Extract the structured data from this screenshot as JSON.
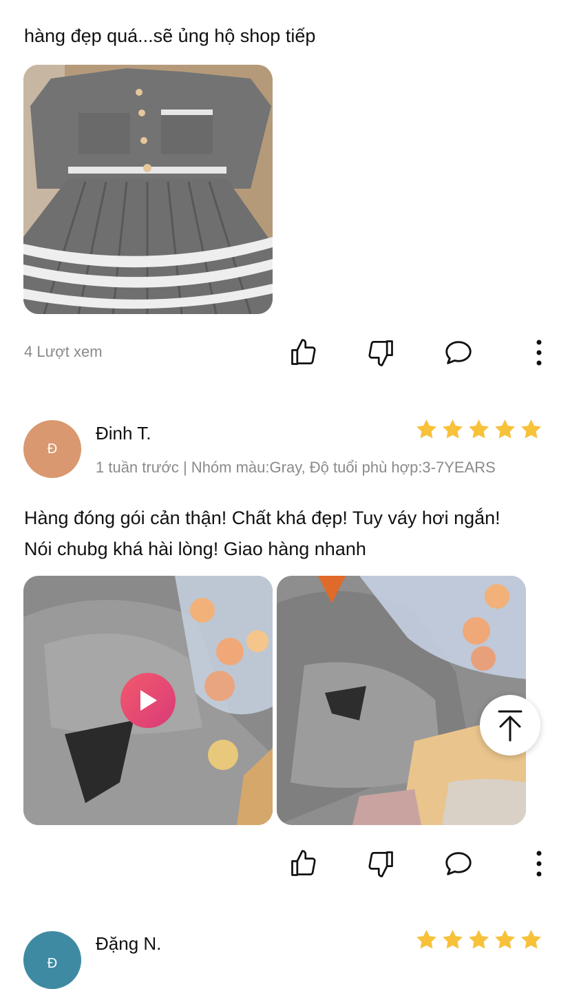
{
  "review1": {
    "text": "hàng đẹp quá...sẽ ủng hộ shop tiếp",
    "photo": "gray knit cardigan and pleated skirt photo",
    "views": "4 Lượt xem"
  },
  "review2": {
    "avatar_letter": "Đ",
    "avatar_color": "#d9986f",
    "name": "Đinh T.",
    "rating": 5,
    "meta": "1 tuần trước | Nhóm màu:Gray, Độ tuổi phù hợp:3-7YEARS",
    "text_line1": "Hàng đóng gói cản thận! Chất khá đẹp! Tuy váy hơi ngắn!",
    "text_line2": "Nói chubg khá hài lòng! Giao hàng nhanh"
  },
  "review3": {
    "avatar_letter": "Đ",
    "avatar_color": "#3f8aa3",
    "name": "Đặng N.",
    "rating": 5
  },
  "colors": {
    "star": "#f7c13a",
    "muted": "#8a8a8a"
  },
  "icons": {
    "like": "thumbs-up-icon",
    "dislike": "thumbs-down-icon",
    "comment": "comment-icon",
    "more": "more-vertical-icon",
    "play": "play-icon",
    "scroll_top": "arrow-up-to-top-icon"
  }
}
